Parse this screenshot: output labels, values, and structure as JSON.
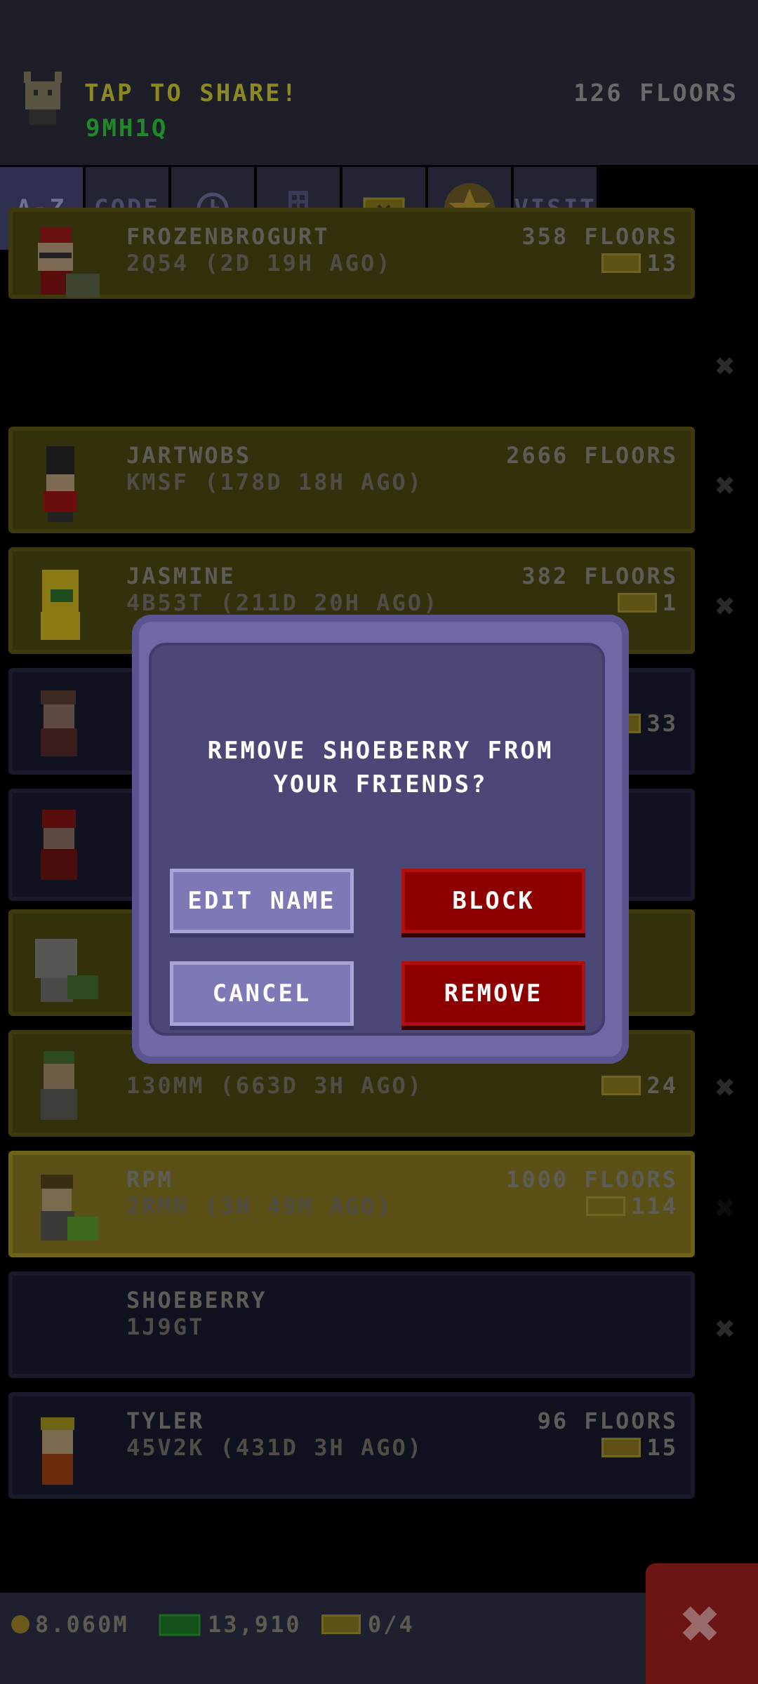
{
  "header": {
    "share_label": "TAP TO SHARE!",
    "share_code": "9MH1Q",
    "floors": "126 FLOORS"
  },
  "tabs": [
    {
      "label": "A-Z",
      "icon": "",
      "active": true
    },
    {
      "label": "CODE",
      "icon": ""
    },
    {
      "label": "",
      "icon": "clock-icon"
    },
    {
      "label": "",
      "icon": "building-icon"
    },
    {
      "label": "",
      "icon": "ticket-icon"
    },
    {
      "label": "",
      "icon": "star-icon"
    },
    {
      "label": "VISIT",
      "icon": ""
    }
  ],
  "friends": [
    {
      "name": "FROZENBROGURT",
      "sub": "2Q54 (2D 19H AGO)",
      "floors": "358 FLOORS",
      "tickets": "13"
    },
    {
      "name": "JARTWOBS",
      "sub": "KMSF (178D 18H AGO)",
      "floors": "2666 FLOORS",
      "tickets": ""
    },
    {
      "name": "JASMINE",
      "sub": "4B53T (211D 20H AGO)",
      "floors": "382 FLOORS",
      "tickets": "1"
    },
    {
      "name": "",
      "sub": "",
      "floors": "",
      "tickets": "33"
    },
    {
      "name": "",
      "sub": "",
      "floors": "",
      "tickets": ""
    },
    {
      "name": "",
      "sub": "",
      "floors": "",
      "tickets": ""
    },
    {
      "name": "",
      "sub": "130MM (663D 3H AGO)",
      "floors": "",
      "tickets": "24"
    },
    {
      "name": "RPM",
      "sub": "2RMN (3H 49M AGO)",
      "floors": "1000 FLOORS",
      "tickets": "114"
    },
    {
      "name": "SHOEBERRY",
      "sub": "1J9GT",
      "floors": "",
      "tickets": ""
    },
    {
      "name": "TYLER",
      "sub": "45V2K (431D 3H AGO)",
      "floors": "96 FLOORS",
      "tickets": "15"
    }
  ],
  "dialog": {
    "title_line1": "REMOVE SHOEBERRY FROM",
    "title_line2": "YOUR FRIENDS?",
    "edit_name": "EDIT NAME",
    "block": "BLOCK",
    "cancel": "CANCEL",
    "remove": "REMOVE"
  },
  "footer": {
    "coins": "8.060M",
    "bux": "13,910",
    "tickets": "0/4"
  },
  "colors": {
    "dialog_bg": "#4b4878",
    "danger": "#8e0000",
    "purple_button": "#7d78b6"
  }
}
